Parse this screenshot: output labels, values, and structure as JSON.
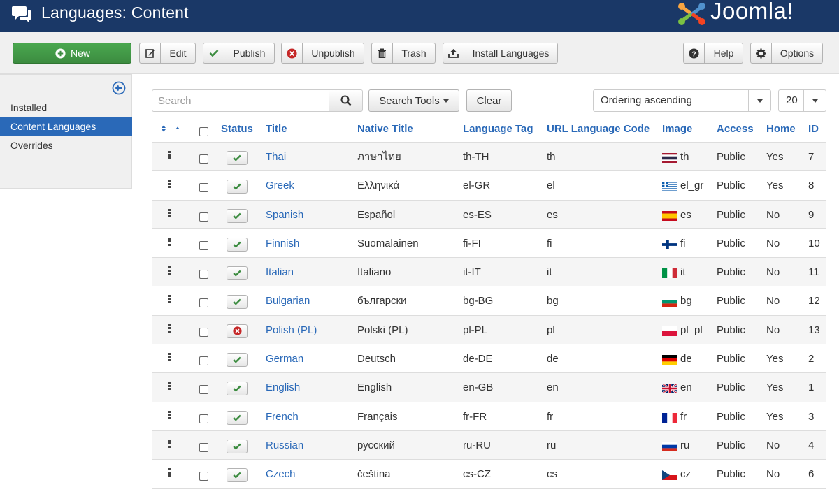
{
  "header": {
    "title": "Languages: Content",
    "brand": "Joomla!"
  },
  "toolbar": {
    "new": "New",
    "edit": "Edit",
    "publish": "Publish",
    "unpublish": "Unpublish",
    "trash": "Trash",
    "install_languages": "Install Languages",
    "help": "Help",
    "options": "Options"
  },
  "sidebar": {
    "items": [
      {
        "label": "Installed",
        "active": false
      },
      {
        "label": "Content Languages",
        "active": true
      },
      {
        "label": "Overrides",
        "active": false
      }
    ]
  },
  "filters": {
    "search_placeholder": "Search",
    "search_value": "",
    "search_tools": "Search Tools",
    "clear": "Clear",
    "ordering": "Ordering ascending",
    "limit": "20"
  },
  "columns": {
    "status": "Status",
    "title": "Title",
    "native_title": "Native Title",
    "language_tag": "Language Tag",
    "url_code": "URL Language Code",
    "image": "Image",
    "access": "Access",
    "home": "Home",
    "id": "ID"
  },
  "colors": {
    "header_bg": "#1a3867",
    "accent": "#2a69b8",
    "published": "#3c8c40",
    "unpublished": "#c52727",
    "new_button": "#46a546"
  },
  "rows": [
    {
      "title": "Thai",
      "native": "ภาษาไทย",
      "tag": "th-TH",
      "url": "th",
      "image": "th",
      "access": "Public",
      "home": "Yes",
      "id": "7",
      "published": true
    },
    {
      "title": "Greek",
      "native": "Ελληνικά",
      "tag": "el-GR",
      "url": "el",
      "image": "el_gr",
      "access": "Public",
      "home": "Yes",
      "id": "8",
      "published": true
    },
    {
      "title": "Spanish",
      "native": "Español",
      "tag": "es-ES",
      "url": "es",
      "image": "es",
      "access": "Public",
      "home": "No",
      "id": "9",
      "published": true
    },
    {
      "title": "Finnish",
      "native": "Suomalainen",
      "tag": "fi-FI",
      "url": "fi",
      "image": "fi",
      "access": "Public",
      "home": "No",
      "id": "10",
      "published": true
    },
    {
      "title": "Italian",
      "native": "Italiano",
      "tag": "it-IT",
      "url": "it",
      "image": "it",
      "access": "Public",
      "home": "No",
      "id": "11",
      "published": true
    },
    {
      "title": "Bulgarian",
      "native": "български",
      "tag": "bg-BG",
      "url": "bg",
      "image": "bg",
      "access": "Public",
      "home": "No",
      "id": "12",
      "published": true
    },
    {
      "title": "Polish (PL)",
      "native": "Polski (PL)",
      "tag": "pl-PL",
      "url": "pl",
      "image": "pl_pl",
      "access": "Public",
      "home": "No",
      "id": "13",
      "published": false
    },
    {
      "title": "German",
      "native": "Deutsch",
      "tag": "de-DE",
      "url": "de",
      "image": "de",
      "access": "Public",
      "home": "Yes",
      "id": "2",
      "published": true
    },
    {
      "title": "English",
      "native": "English",
      "tag": "en-GB",
      "url": "en",
      "image": "en",
      "access": "Public",
      "home": "Yes",
      "id": "1",
      "published": true
    },
    {
      "title": "French",
      "native": "Français",
      "tag": "fr-FR",
      "url": "fr",
      "image": "fr",
      "access": "Public",
      "home": "Yes",
      "id": "3",
      "published": true
    },
    {
      "title": "Russian",
      "native": "русский",
      "tag": "ru-RU",
      "url": "ru",
      "image": "ru",
      "access": "Public",
      "home": "No",
      "id": "4",
      "published": true
    },
    {
      "title": "Czech",
      "native": "čeština",
      "tag": "cs-CZ",
      "url": "cs",
      "image": "cz",
      "access": "Public",
      "home": "No",
      "id": "6",
      "published": true
    }
  ]
}
